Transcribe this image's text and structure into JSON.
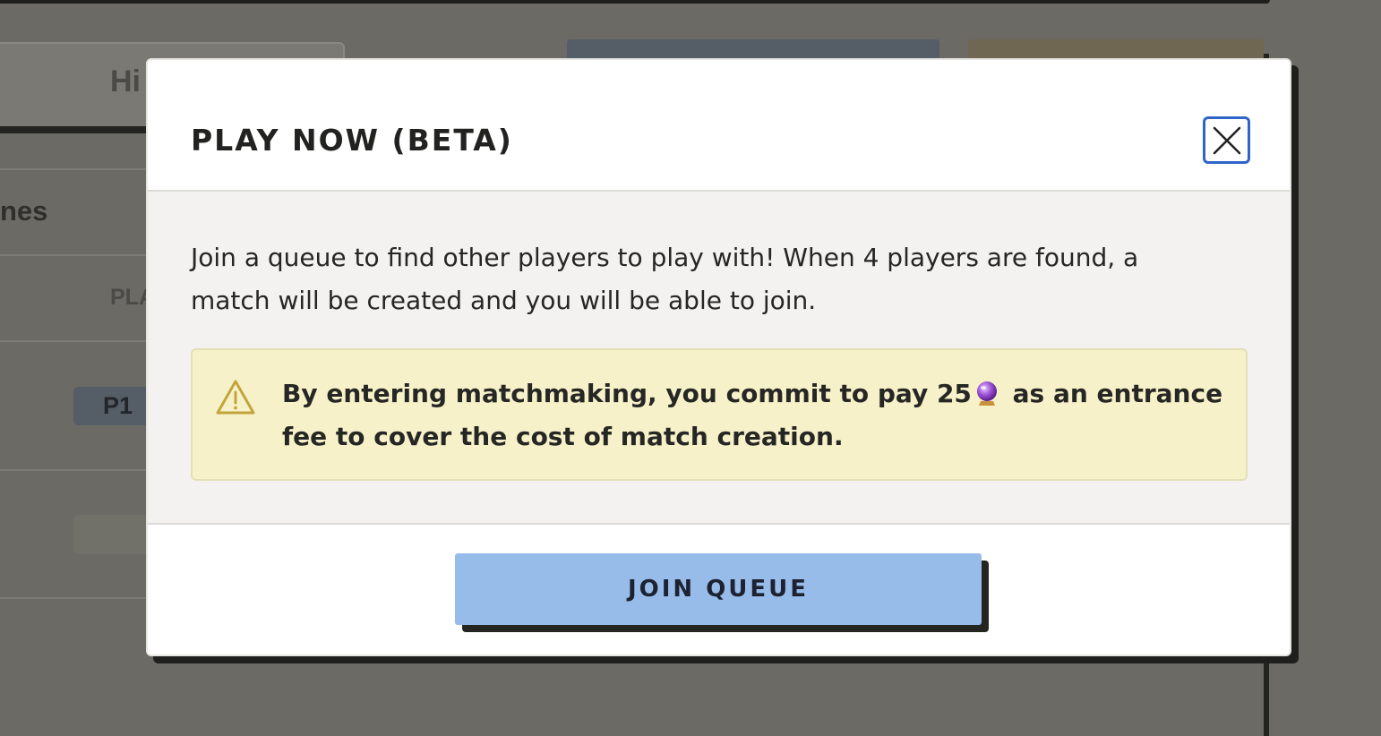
{
  "background": {
    "tab_label": "Hi",
    "table_text": "nes",
    "column_header": "PLA",
    "player_badge": "P1"
  },
  "modal": {
    "title": "PLAY NOW (BETA)",
    "close_icon": "close-x-icon",
    "intro": "Join a queue to find other players to play with! When 4 players are found, a match will be created and you will be able to join.",
    "warning": {
      "icon": "warning-triangle-icon",
      "text_before": "By entering matchmaking, you commit to pay 25",
      "currency_icon": "crystal-ball-icon",
      "text_after": " as an entrance fee to cover the cost of match creation."
    },
    "join_button_label": "JOIN QUEUE"
  },
  "colors": {
    "overlay": "#6b6a64",
    "close_border": "#2f64c8",
    "warning_bg": "#f6f1c8",
    "warning_icon": "#c2a53a",
    "join_button": "#98bcea"
  }
}
